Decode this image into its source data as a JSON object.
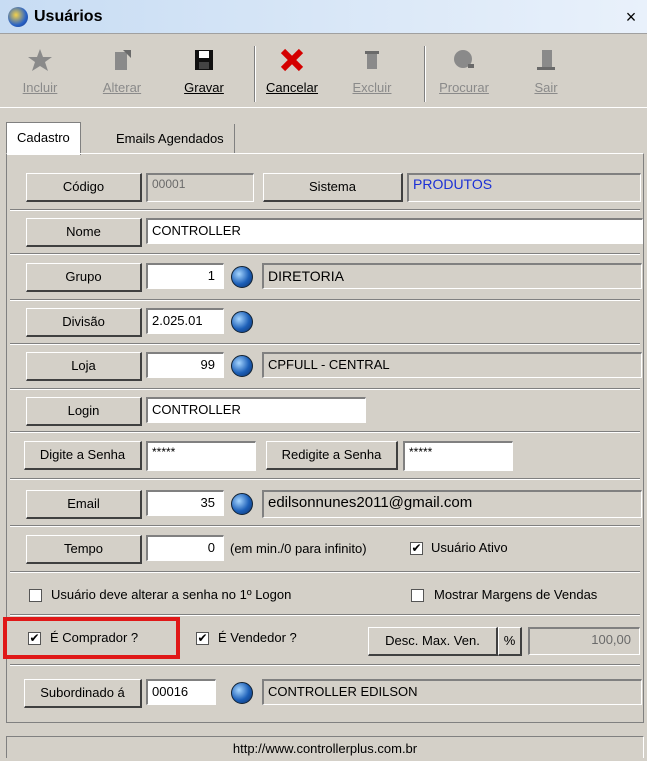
{
  "window": {
    "title": "Usuários",
    "close_label": "×"
  },
  "toolbar": {
    "incluir": "Incluir",
    "alterar": "Alterar",
    "gravar": "Gravar",
    "cancelar": "Cancelar",
    "excluir": "Excluir",
    "procurar": "Procurar",
    "sair": "Sair"
  },
  "tabs": {
    "cadastro": "Cadastro",
    "emails": "Emails Agendados"
  },
  "form": {
    "codigo_label": "Código",
    "codigo_value": "00001",
    "sistema_label": "Sistema",
    "sistema_value": "PRODUTOS",
    "nome_label": "Nome",
    "nome_value": "CONTROLLER",
    "grupo_label": "Grupo",
    "grupo_value": "1",
    "grupo_desc": "DIRETORIA",
    "divisao_label": "Divisão",
    "divisao_value": "2.025.01",
    "loja_label": "Loja",
    "loja_value": "99",
    "loja_desc": "CPFULL - CENTRAL",
    "login_label": "Login",
    "login_value": "CONTROLLER",
    "senha_label": "Digite a Senha",
    "senha_value": "*****",
    "redigite_label": "Redigite a Senha",
    "redigite_value": "*****",
    "email_label": "Email",
    "email_value": "35",
    "email_desc": "edilsonnunes2011@gmail.com",
    "tempo_label": "Tempo",
    "tempo_value": "0",
    "tempo_hint": "(em min./0 para infinito)",
    "usuario_ativo": "Usuário Ativo",
    "alterar_senha": "Usuário deve alterar a senha no 1º Logon",
    "mostrar_margens": "Mostrar Margens de Vendas",
    "comprador": "É Comprador ?",
    "vendedor": "É Vendedor ?",
    "desc_label": "Desc. Max. Ven.",
    "desc_pct": "%",
    "desc_value": "100,00",
    "subordinado_label": "Subordinado á",
    "subordinado_value": "00016",
    "subordinado_desc": "CONTROLLER EDILSON"
  },
  "status": {
    "url": "http://www.controllerplus.com.br"
  },
  "colors": {
    "sistema_text": "#1a2fd6",
    "highlight": "#e01818"
  }
}
